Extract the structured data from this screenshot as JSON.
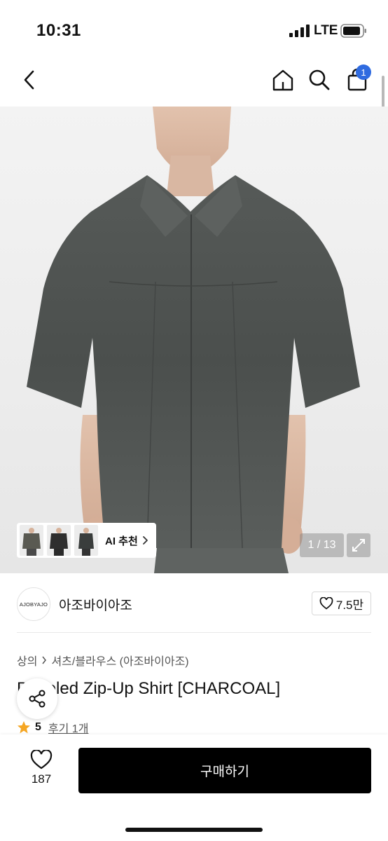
{
  "status_bar": {
    "time": "10:31",
    "network": "LTE",
    "icons": [
      "signal-bars-icon",
      "battery-icon"
    ]
  },
  "nav": {
    "icons": [
      "back-chevron-icon",
      "home-icon",
      "search-icon",
      "shopping-bag-icon"
    ],
    "cart_count": "1"
  },
  "gallery": {
    "thumbnails": [
      "thumbnail-1",
      "thumbnail-2",
      "thumbnail-3"
    ],
    "ai_label": "AI 추천",
    "counter": "1 / 13",
    "expand_icon": "expand-icon"
  },
  "brand": {
    "logo_text": "AJOBYAJO",
    "name": "아조바이아조",
    "like_count": "7.5만"
  },
  "breadcrumb": {
    "category": "상의",
    "subcategory": "셔츠/블라우스 (아조바이아조)"
  },
  "product": {
    "title": "Paneled Zip-Up Shirt [CHARCOAL]",
    "rating": "5",
    "reviews": "후기 1개"
  },
  "bottom": {
    "wish_count": "187",
    "buy_label": "구매하기"
  },
  "colors": {
    "accent": "#2f6be0",
    "buy_button": "#000000",
    "rating_star": "#f5a623",
    "shirt": "#4d514f"
  }
}
